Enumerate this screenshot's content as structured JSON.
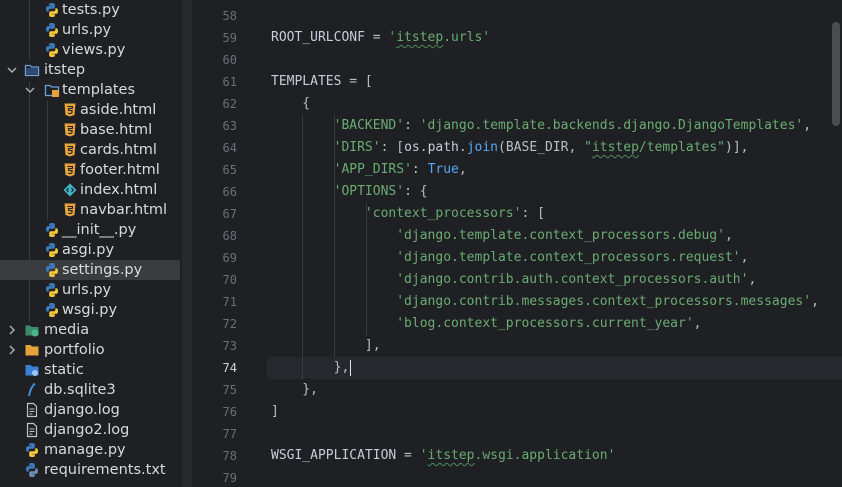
{
  "sidebar": {
    "items": [
      {
        "label": "tests.py",
        "icon": "python-icon"
      },
      {
        "label": "urls.py",
        "icon": "python-icon"
      },
      {
        "label": "views.py",
        "icon": "python-icon"
      },
      {
        "label": "itstep",
        "icon": "folder-icon"
      },
      {
        "label": "templates",
        "icon": "template-folder-icon"
      },
      {
        "label": "aside.html",
        "icon": "html5-icon"
      },
      {
        "label": "base.html",
        "icon": "html5-icon"
      },
      {
        "label": "cards.html",
        "icon": "html5-icon"
      },
      {
        "label": "footer.html",
        "icon": "html5-icon"
      },
      {
        "label": "index.html",
        "icon": "html-angular-icon"
      },
      {
        "label": "navbar.html",
        "icon": "html5-icon"
      },
      {
        "label": "__init__.py",
        "icon": "python-icon"
      },
      {
        "label": "asgi.py",
        "icon": "python-icon"
      },
      {
        "label": "settings.py",
        "icon": "python-icon"
      },
      {
        "label": "urls.py",
        "icon": "python-icon"
      },
      {
        "label": "wsgi.py",
        "icon": "python-icon"
      },
      {
        "label": "media",
        "icon": "media-folder-icon"
      },
      {
        "label": "portfolio",
        "icon": "folder-icon"
      },
      {
        "label": "static",
        "icon": "static-folder-icon"
      },
      {
        "label": "db.sqlite3",
        "icon": "database-icon"
      },
      {
        "label": "django.log",
        "icon": "log-file-icon"
      },
      {
        "label": "django2.log",
        "icon": "log-file-icon"
      },
      {
        "label": "manage.py",
        "icon": "python-icon"
      },
      {
        "label": "requirements.txt",
        "icon": "requirements-icon"
      }
    ]
  },
  "editor": {
    "current_line": "74",
    "lines": [
      {
        "num": "58",
        "segs": []
      },
      {
        "num": "59",
        "segs": [
          {
            "t": "ROOT_URLCONF",
            "c": "t-var"
          },
          {
            "t": " = ",
            "c": ""
          },
          {
            "t": "'",
            "c": "t-str"
          },
          {
            "t": "itstep",
            "c": "t-str wavy"
          },
          {
            "t": ".urls'",
            "c": "t-str"
          }
        ]
      },
      {
        "num": "60",
        "segs": []
      },
      {
        "num": "61",
        "segs": [
          {
            "t": "TEMPLATES",
            "c": "t-var"
          },
          {
            "t": " = [",
            "c": ""
          }
        ]
      },
      {
        "num": "62",
        "segs": [
          {
            "t": "    {",
            "c": ""
          }
        ]
      },
      {
        "num": "63",
        "segs": [
          {
            "t": "        ",
            "c": ""
          },
          {
            "t": "'BACKEND'",
            "c": "t-str"
          },
          {
            "t": ": ",
            "c": ""
          },
          {
            "t": "'django.template.backends.django.DjangoTemplates'",
            "c": "t-str"
          },
          {
            "t": ",",
            "c": ""
          }
        ]
      },
      {
        "num": "64",
        "segs": [
          {
            "t": "        ",
            "c": ""
          },
          {
            "t": "'DIRS'",
            "c": "t-str"
          },
          {
            "t": ": [",
            "c": ""
          },
          {
            "t": "os",
            "c": "t-mod"
          },
          {
            "t": ".",
            "c": ""
          },
          {
            "t": "path",
            "c": "t-mod"
          },
          {
            "t": ".",
            "c": ""
          },
          {
            "t": "join",
            "c": "t-fn"
          },
          {
            "t": "(BASE_DIR, ",
            "c": ""
          },
          {
            "t": "\"",
            "c": "t-str"
          },
          {
            "t": "itstep",
            "c": "t-str wavy"
          },
          {
            "t": "/templates\"",
            "c": "t-str"
          },
          {
            "t": ")],",
            "c": ""
          }
        ]
      },
      {
        "num": "65",
        "segs": [
          {
            "t": "        ",
            "c": ""
          },
          {
            "t": "'APP_DIRS'",
            "c": "t-str"
          },
          {
            "t": ": ",
            "c": ""
          },
          {
            "t": "True",
            "c": "t-const"
          },
          {
            "t": ",",
            "c": ""
          }
        ]
      },
      {
        "num": "66",
        "segs": [
          {
            "t": "        ",
            "c": ""
          },
          {
            "t": "'OPTIONS'",
            "c": "t-str"
          },
          {
            "t": ": {",
            "c": ""
          }
        ]
      },
      {
        "num": "67",
        "segs": [
          {
            "t": "            ",
            "c": ""
          },
          {
            "t": "'context_processors'",
            "c": "t-str"
          },
          {
            "t": ": [",
            "c": ""
          }
        ]
      },
      {
        "num": "68",
        "segs": [
          {
            "t": "                ",
            "c": ""
          },
          {
            "t": "'django.template.context_processors.debug'",
            "c": "t-str"
          },
          {
            "t": ",",
            "c": ""
          }
        ]
      },
      {
        "num": "69",
        "segs": [
          {
            "t": "                ",
            "c": ""
          },
          {
            "t": "'django.template.context_processors.request'",
            "c": "t-str"
          },
          {
            "t": ",",
            "c": ""
          }
        ]
      },
      {
        "num": "70",
        "segs": [
          {
            "t": "                ",
            "c": ""
          },
          {
            "t": "'django.contrib.auth.context_processors.auth'",
            "c": "t-str"
          },
          {
            "t": ",",
            "c": ""
          }
        ]
      },
      {
        "num": "71",
        "segs": [
          {
            "t": "                ",
            "c": ""
          },
          {
            "t": "'django.contrib.messages.context_processors.messages'",
            "c": "t-str"
          },
          {
            "t": ",",
            "c": ""
          }
        ]
      },
      {
        "num": "72",
        "segs": [
          {
            "t": "                ",
            "c": ""
          },
          {
            "t": "'blog.context_processors.current_year'",
            "c": "t-str"
          },
          {
            "t": ",",
            "c": ""
          }
        ]
      },
      {
        "num": "73",
        "segs": [
          {
            "t": "            ],",
            "c": ""
          }
        ]
      },
      {
        "num": "74",
        "segs": [
          {
            "t": "        },",
            "c": ""
          }
        ]
      },
      {
        "num": "75",
        "segs": [
          {
            "t": "    },",
            "c": ""
          }
        ]
      },
      {
        "num": "76",
        "segs": [
          {
            "t": "]",
            "c": ""
          }
        ]
      },
      {
        "num": "77",
        "segs": []
      },
      {
        "num": "78",
        "segs": [
          {
            "t": "WSGI_APPLICATION",
            "c": "t-var"
          },
          {
            "t": " = ",
            "c": ""
          },
          {
            "t": "'",
            "c": "t-str"
          },
          {
            "t": "itstep",
            "c": "t-str wavy"
          },
          {
            "t": ".wsgi.application'",
            "c": "t-str"
          }
        ]
      },
      {
        "num": "79",
        "segs": []
      }
    ]
  }
}
